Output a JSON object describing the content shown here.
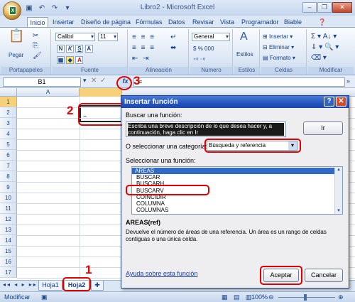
{
  "window": {
    "title": "Libro2 - Microsoft Excel"
  },
  "qat": {
    "icons": [
      "save-icon",
      "undo-icon",
      "redo-icon",
      "customize-icon"
    ]
  },
  "tabs": [
    "Inicio",
    "Insertar",
    "Diseño de página",
    "Fórmulas",
    "Datos",
    "Revisar",
    "Vista",
    "Programador",
    "Biable"
  ],
  "ribbon": {
    "clipboard": {
      "label": "Portapapeles",
      "paste": "Pegar"
    },
    "font": {
      "label": "Fuente",
      "name": "Calibri",
      "size": "11",
      "bold": "N",
      "italic": "K",
      "underline": "S"
    },
    "alignment": {
      "label": "Alineación"
    },
    "number": {
      "label": "Número",
      "format": "General",
      "currency": "$",
      "percent": "%",
      "thousands": "000"
    },
    "styles": {
      "label": "Estilos"
    },
    "cells": {
      "label": "Celdas",
      "insert": "Insertar",
      "delete": "Eliminar",
      "format": "Formato"
    },
    "editing": {
      "label": "Modificar"
    }
  },
  "formula_bar": {
    "name_box": "B1",
    "fx": "fx",
    "value": "="
  },
  "grid": {
    "columns": [
      "A"
    ],
    "rows": [
      "1",
      "2",
      "3",
      "4",
      "5",
      "6",
      "7",
      "8",
      "9",
      "10",
      "11",
      "12",
      "13",
      "14",
      "15",
      "16",
      "17"
    ],
    "b1_value": "="
  },
  "sheets": {
    "tabs": [
      "Hoja1",
      "Hoja2"
    ],
    "active": "Hoja2"
  },
  "status": {
    "mode": "Modificar",
    "zoom": "100%"
  },
  "dialog": {
    "title": "Insertar función",
    "search_label": "Buscar una función:",
    "search_value": "Escriba una breve descripción de lo que desea hacer y, a continuación, haga clic en Ir",
    "go_button": "Ir",
    "category_label": "O seleccionar una categoría:",
    "category_value": "Búsqueda y referencia",
    "select_label": "Seleccionar una función:",
    "functions": [
      "AREAS",
      "BUSCAR",
      "BUSCARH",
      "BUSCARV",
      "COINCIDIR",
      "COLUMNA",
      "COLUMNAS"
    ],
    "selected_function": "AREAS",
    "signature": "AREAS(ref)",
    "description": "Devuelve el número de áreas de una referencia. Un área es un rango de celdas contiguas o una única celda.",
    "help_link": "Ayuda sobre esta función",
    "ok_button": "Aceptar",
    "cancel_button": "Cancelar"
  },
  "annotations": {
    "step1": "1",
    "step2": "2",
    "step3": "3"
  }
}
